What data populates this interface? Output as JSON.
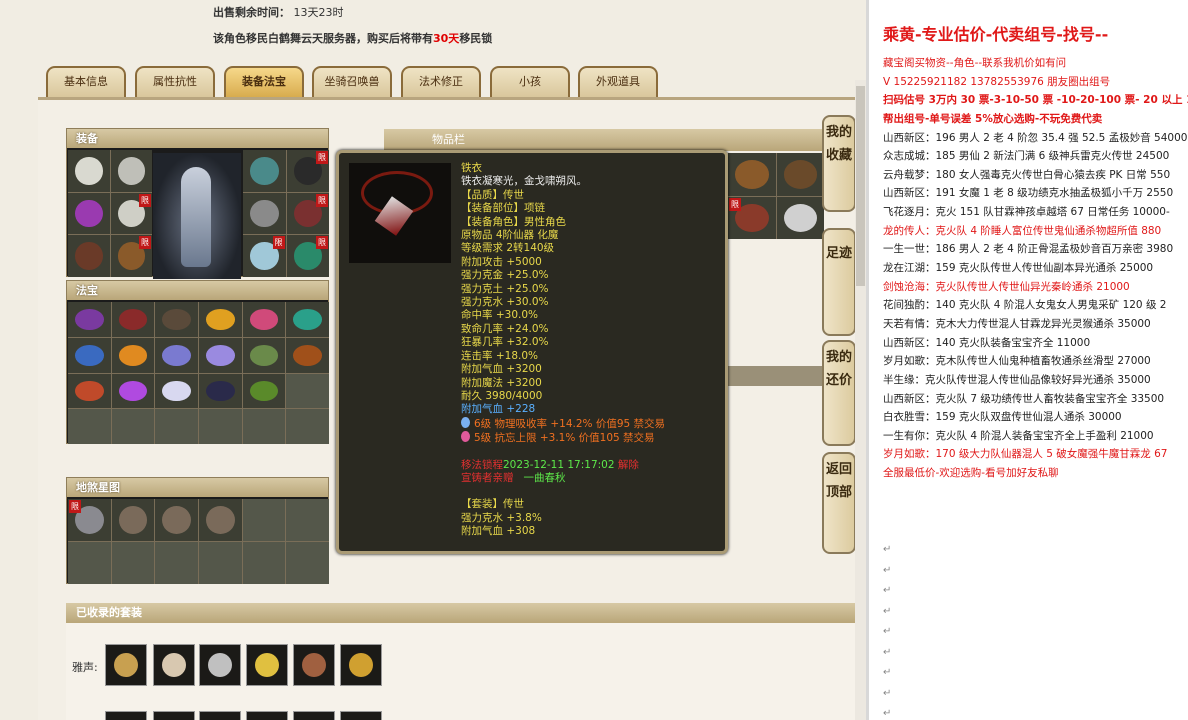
{
  "sale_time": {
    "label": "出售剩余时间：",
    "value": "13天23时"
  },
  "migrate_notice": {
    "before": "该角色移民白鹤舞云天服务器，购买后将带有",
    "days": "30天",
    "after": "移民锁"
  },
  "tabs": [
    {
      "label": "基本信息"
    },
    {
      "label": "属性抗性"
    },
    {
      "label": "装备法宝"
    },
    {
      "label": "坐骑召唤兽"
    },
    {
      "label": "法术修正"
    },
    {
      "label": "小孩"
    },
    {
      "label": "外观道具"
    }
  ],
  "active_tab": 2,
  "panels": {
    "equipment": "装备",
    "treasure": "法宝",
    "fengshou": "地煞星图",
    "itembar": "物品栏",
    "sets": "已收录的套装"
  },
  "set_label": "雅声:",
  "side_buttons": [
    {
      "label": "我的收藏"
    },
    {
      "label": "足迹"
    },
    {
      "label": "我的还价"
    },
    {
      "label": "返回顶部"
    }
  ],
  "limit_tag": "限",
  "tooltip": {
    "name": "铁衣",
    "desc": "铁衣凝寒光，金戈啸朔风。",
    "quality": "【品质】传世",
    "slot": "【装备部位】项链",
    "role": "【装备角色】男性角色",
    "origin": "原物品  4阶仙器  化魔",
    "requirement": "等级需求  2转140级",
    "stats": [
      "附加攻击 +5000",
      "强力克金 +25.0%",
      "强力克土 +25.0%",
      "强力克水 +30.0%",
      "命中率 +30.0%",
      "致命几率 +24.0%",
      "狂暴几率 +32.0%",
      "连击率 +18.0%",
      "附加气血 +3200",
      "附加魔法 +3200"
    ],
    "durability": "耐久  3980/4000",
    "extra_blue": "附加气血  +228",
    "gem1": "6级  物理吸收率 +14.2%  价值95  禁交易",
    "gem2": "5级  抗忘上限 +3.1%  价值105  禁交易",
    "lock_label": "移法锁程",
    "lock_time": "2023-12-11 17:17:02",
    "lock_tail": "解除",
    "owner_label": "宣铸者亲赠",
    "owner_name": "一曲春秋",
    "set_label": "【套装】传世",
    "set_stats": [
      "强力克水 +3.8%",
      "附加气血 +308"
    ]
  },
  "right": {
    "title": "乘黄-专业估价-代卖组号-找号--",
    "lines": [
      {
        "c": "rr",
        "t": "藏宝阁买物资--角色--联系我机价如有问"
      },
      {
        "c": "rr",
        "t": "V 15225921182    13782553976 朋友圈出组号"
      },
      {
        "c": "rb",
        "t": "扫码估号 3万内 30 票-3-10-50 票  -10-20-100 票- 20 以上 1"
      },
      {
        "c": "rb",
        "t": "帮出组号-单号误差 5%放心选购-不玩免费代卖"
      },
      {
        "c": "rd",
        "t": "山西新区：196 男人 2 老 4 阶忽 35.4 强 52.5 孟极妙音 54000"
      },
      {
        "c": "rd",
        "t": "众志成城：185 男仙 2 新法门满 6 级神兵雷克火传世 24500"
      },
      {
        "c": "rd",
        "t": "云舟载梦：180 女人强毒克火传世白骨心猿去疾 PK 日常 550"
      },
      {
        "c": "rd",
        "t": "山西新区：191 女魔 1 老 8 级功绩克水抽孟极狐小千万 2550"
      },
      {
        "c": "rd",
        "t": "飞花逐月：克火 151 队甘霖神孩卓越塔 67 日常任务 10000-"
      },
      {
        "c": "rr",
        "t": "龙的传人：克火队 4 阶睡人富位传世鬼仙通杀物超所值 880"
      },
      {
        "c": "rd",
        "t": "一生一世：186 男人 2 老 4 阶正骨混孟极妙音百万亲密 3980"
      },
      {
        "c": "rd",
        "t": "龙在江湖：159 克火队传世人传世仙副本异光通杀 25000"
      },
      {
        "c": "rr",
        "t": "剑蚀沧海：克火队传世人传世仙异光秦岭通杀 21000"
      },
      {
        "c": "rd",
        "t": "花间独酌：140 克火队 4 阶混人女鬼女人男鬼采矿 120 级 2"
      },
      {
        "c": "rd",
        "t": "天若有情：克木大力传世混人甘霖龙异光灵猴通杀 35000"
      },
      {
        "c": "rd",
        "t": "山西新区：140 克火队装备宝宝齐全 11000"
      },
      {
        "c": "rd",
        "t": "岁月如歌：克木队传世人仙鬼种植畜牧通杀丝滑型 27000"
      },
      {
        "c": "rd",
        "t": "半生缘：克火队传世混人传世仙品像较好异光通杀 35000"
      },
      {
        "c": "rd",
        "t": "山西新区：克火队 7 级功绩传世人畜牧装备宝宝齐全 33500"
      },
      {
        "c": "rd",
        "t": "白衣胜雪：159 克火队双盘传世仙混人通杀 30000"
      },
      {
        "c": "rd",
        "t": "一生有你：克火队 4 阶混人装备宝宝齐全上手盈利 21000"
      },
      {
        "c": "rr",
        "t": "岁月如歌：170 级大力队仙器混人 5 破女魔强牛魔甘霖龙 67"
      },
      {
        "c": "rr",
        "t": "全服最低价-欢迎选购-看号加好友私聊"
      }
    ]
  }
}
